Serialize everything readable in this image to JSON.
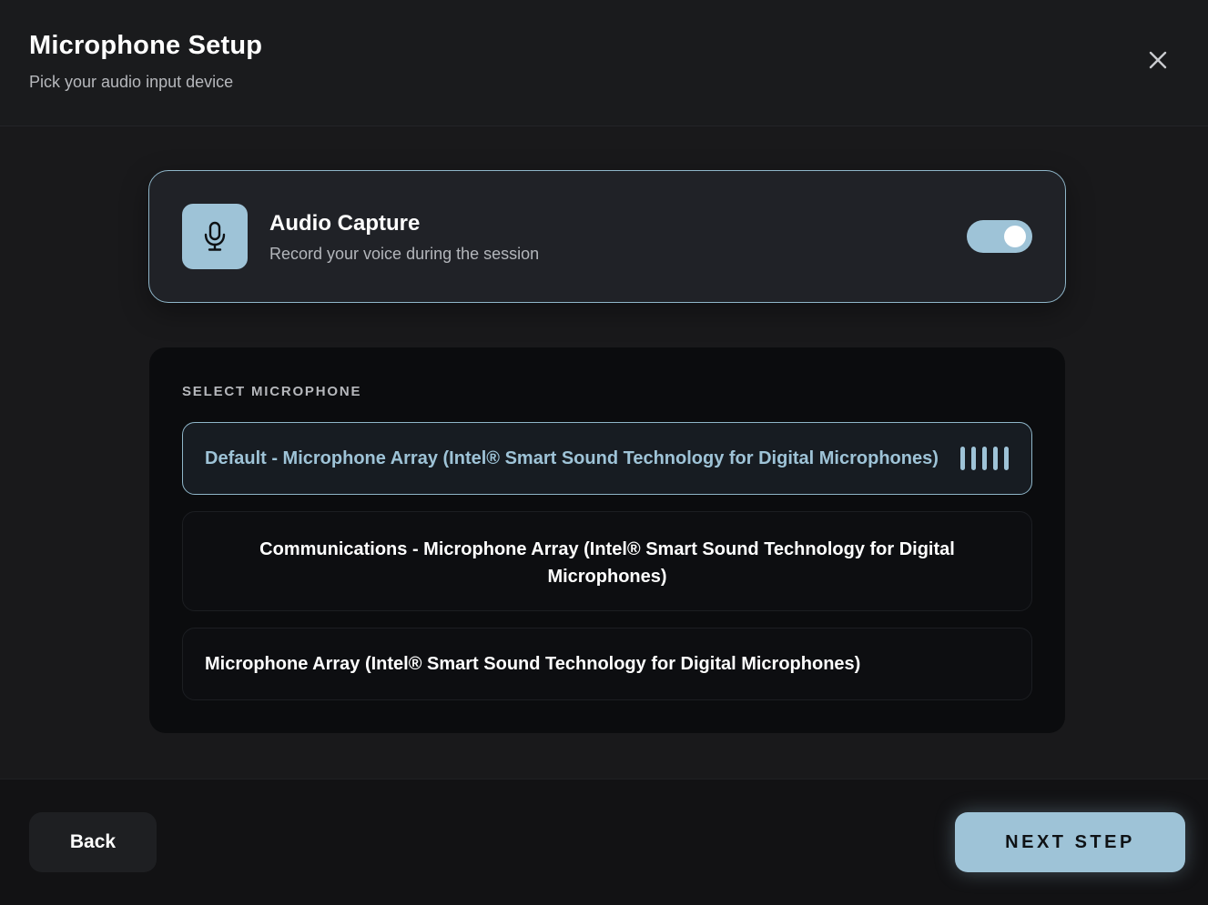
{
  "header": {
    "title": "Microphone Setup",
    "subtitle": "Pick your audio input device",
    "close_icon": "close-icon"
  },
  "audio_capture": {
    "icon": "microphone-icon",
    "title": "Audio Capture",
    "description": "Record your voice during the session",
    "enabled": true
  },
  "microphones": {
    "section_label": "SELECT MICROPHONE",
    "items": [
      {
        "label": "Default - Microphone Array (Intel® Smart Sound Technology for Digital Microphones)",
        "selected": true,
        "level_icon": "audio-level-icon"
      },
      {
        "label": "Communications - Microphone Array (Intel® Smart Sound Technology for Digital Microphones)",
        "selected": false
      },
      {
        "label": "Microphone Array (Intel® Smart Sound Technology for Digital Microphones)",
        "selected": false
      }
    ]
  },
  "footer": {
    "back_label": "Back",
    "next_label": "NEXT STEP"
  },
  "colors": {
    "accent": "#9ec3d7",
    "background": "#19191b",
    "panel": "#0b0c0e",
    "card": "#202227"
  }
}
